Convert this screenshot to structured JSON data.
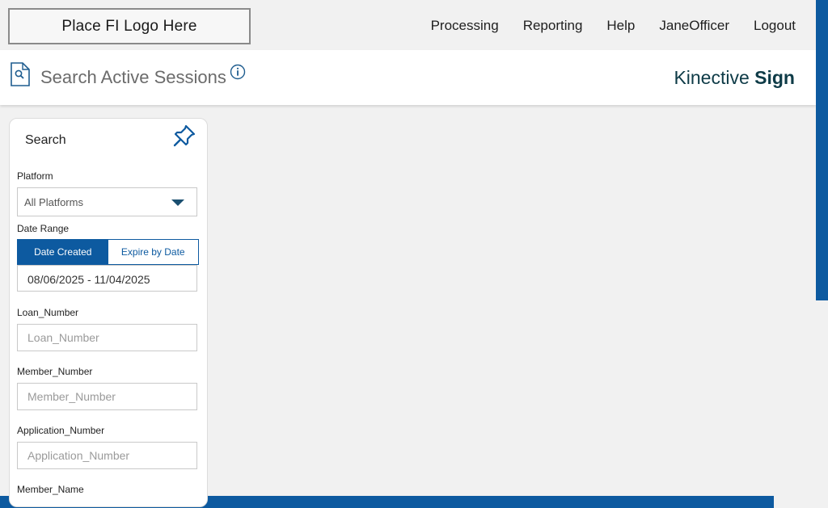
{
  "header": {
    "logo_placeholder": "Place FI Logo Here",
    "nav": [
      "Processing",
      "Reporting",
      "Help",
      "JaneOfficer",
      "Logout"
    ]
  },
  "titlebar": {
    "title": "Search Active Sessions",
    "brand_light": "Kinective ",
    "brand_bold": "Sign"
  },
  "search_panel": {
    "title": "Search",
    "platform_label": "Platform",
    "platform_value": "All Platforms",
    "date_range_label": "Date Range",
    "date_tabs": [
      "Date Created",
      "Expire by Date"
    ],
    "date_value": "08/06/2025 - 11/04/2025",
    "loan_label": "Loan_Number",
    "loan_placeholder": "Loan_Number",
    "member_label": "Member_Number",
    "member_placeholder": "Member_Number",
    "application_label": "Application_Number",
    "application_placeholder": "Application_Number",
    "member_name_label": "Member_Name"
  },
  "colors": {
    "accent": "#0d5aa0",
    "brand": "#0e3b47"
  },
  "icons": [
    "document-search-icon",
    "info-icon",
    "pin-icon",
    "chevron-down-icon"
  ]
}
